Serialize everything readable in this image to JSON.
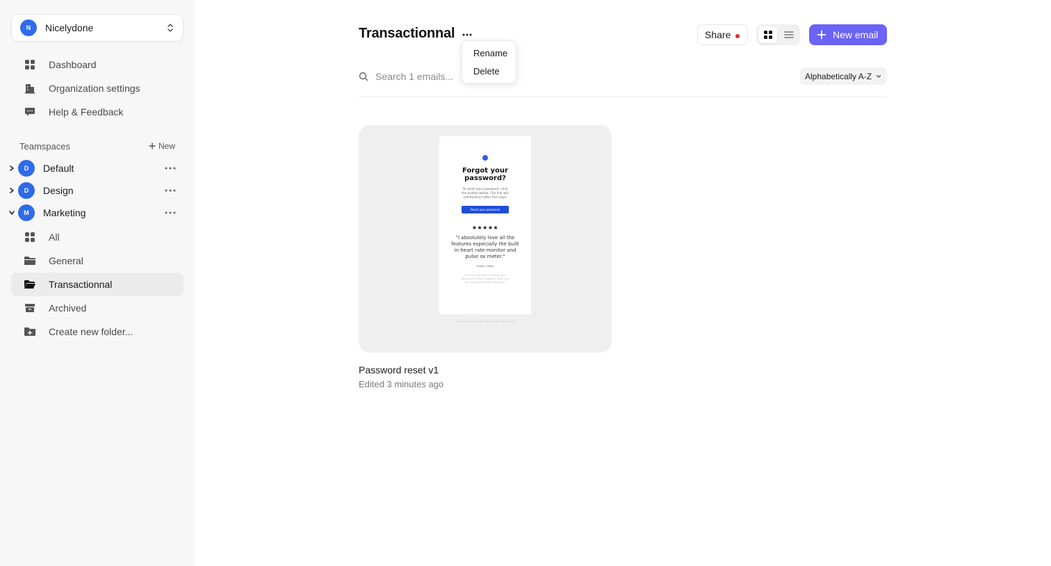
{
  "sidebar": {
    "org": {
      "initial": "N",
      "name": "Nicelydone"
    },
    "nav": [
      {
        "label": "Dashboard",
        "icon": "dashboard-icon"
      },
      {
        "label": "Organization settings",
        "icon": "building-icon"
      },
      {
        "label": "Help & Feedback",
        "icon": "chat-bubble-icon"
      }
    ],
    "teamspaces_title": "Teamspaces",
    "teamspaces_new": "New",
    "teams": [
      {
        "initial": "D",
        "name": "Default",
        "expanded": false
      },
      {
        "initial": "D",
        "name": "Design",
        "expanded": false
      },
      {
        "initial": "M",
        "name": "Marketing",
        "expanded": true
      }
    ],
    "folders": [
      {
        "label": "All",
        "icon": "grid-icon"
      },
      {
        "label": "General",
        "icon": "folder-icon"
      },
      {
        "label": "Transactionnal",
        "icon": "folder-open-icon",
        "active": true
      },
      {
        "label": "Archived",
        "icon": "archive-icon"
      },
      {
        "label": "Create new folder...",
        "icon": "folder-plus-icon"
      }
    ]
  },
  "header": {
    "title": "Transactionnal",
    "menu": {
      "rename": "Rename",
      "delete": "Delete"
    },
    "share_label": "Share",
    "new_email_label": "New email"
  },
  "search": {
    "placeholder": "Search 1 emails..."
  },
  "sort": {
    "label": "Alphabetically A-Z"
  },
  "emails": [
    {
      "title": "Password reset v1",
      "meta": "Edited 3 minutes ago",
      "preview": {
        "heading": "Forgot your password?",
        "body": "To reset your password, click the button below. The link will self-destruct after five days.",
        "button": "Reset your password",
        "stars": "★★★★★",
        "quote": "\"I absolutely love all the features especially the built in heart rate monitor and pulse ox meter.\"",
        "author": "DANIEL JONES",
        "footer": "If you do not want to change your password or didn't request a reset, you can ignore and delete this email.",
        "under": "You received this email because you requested a password reset."
      }
    }
  ],
  "colors": {
    "accent": "#6b63f6",
    "avatar": "#2f6bea",
    "notification": "#e52b2b"
  }
}
